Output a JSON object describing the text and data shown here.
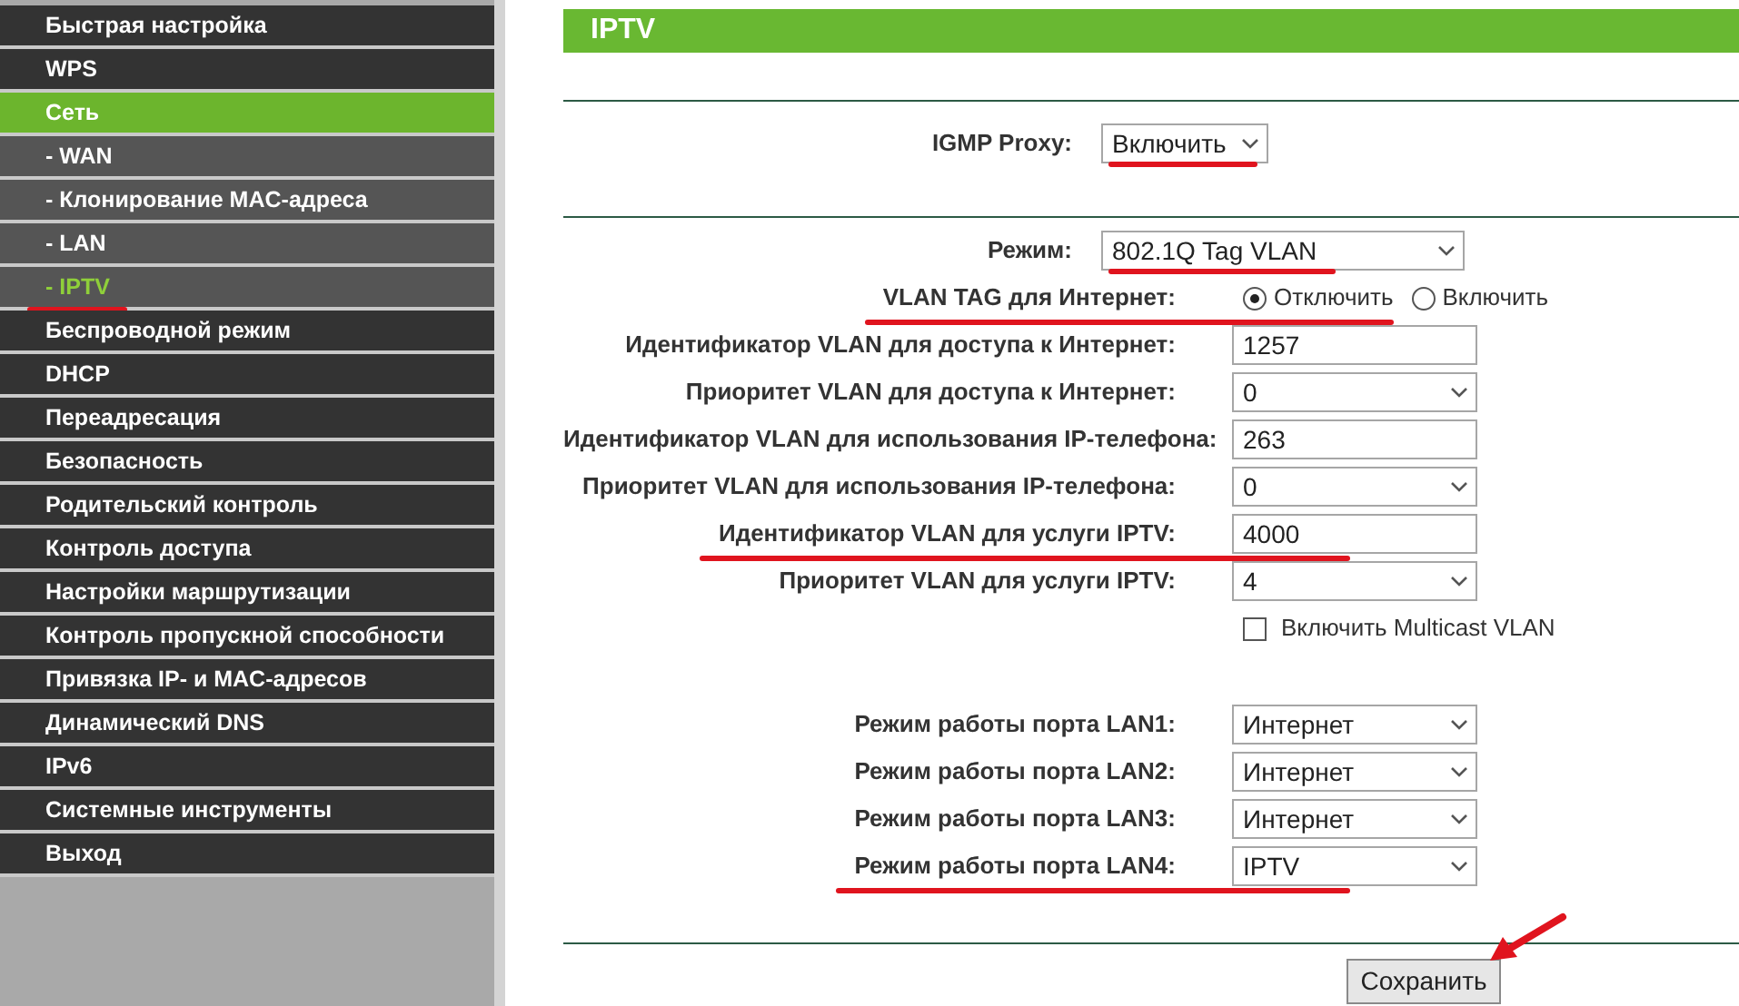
{
  "sidebar": {
    "items": [
      {
        "label": "Быстрая настройка",
        "kind": "main",
        "selected": false,
        "underlined": false
      },
      {
        "label": "WPS",
        "kind": "main",
        "selected": false,
        "underlined": false
      },
      {
        "label": "Сеть",
        "kind": "main",
        "selected": true,
        "underlined": false
      },
      {
        "label": "- WAN",
        "kind": "sub",
        "selected": false,
        "underlined": false
      },
      {
        "label": "- Клонирование MAC-адреса",
        "kind": "sub",
        "selected": false,
        "underlined": false
      },
      {
        "label": "- LAN",
        "kind": "sub",
        "selected": false,
        "underlined": false
      },
      {
        "label": "- IPTV",
        "kind": "sub",
        "selected": true,
        "underlined": true
      },
      {
        "label": "Беспроводной режим",
        "kind": "main",
        "selected": false,
        "underlined": false
      },
      {
        "label": "DHCP",
        "kind": "main",
        "selected": false,
        "underlined": false
      },
      {
        "label": "Переадресация",
        "kind": "main",
        "selected": false,
        "underlined": false
      },
      {
        "label": "Безопасность",
        "kind": "main",
        "selected": false,
        "underlined": false
      },
      {
        "label": "Родительский контроль",
        "kind": "main",
        "selected": false,
        "underlined": false
      },
      {
        "label": "Контроль доступа",
        "kind": "main",
        "selected": false,
        "underlined": false
      },
      {
        "label": "Настройки маршрутизации",
        "kind": "main",
        "selected": false,
        "underlined": false
      },
      {
        "label": "Контроль пропускной способности",
        "kind": "main",
        "selected": false,
        "underlined": false
      },
      {
        "label": "Привязка IP- и MAC-адресов",
        "kind": "main",
        "selected": false,
        "underlined": false
      },
      {
        "label": "Динамический DNS",
        "kind": "main",
        "selected": false,
        "underlined": false
      },
      {
        "label": "IPv6",
        "kind": "main",
        "selected": false,
        "underlined": false
      },
      {
        "label": "Системные инструменты",
        "kind": "main",
        "selected": false,
        "underlined": false
      },
      {
        "label": "Выход",
        "kind": "main",
        "selected": false,
        "underlined": false
      }
    ]
  },
  "panel": {
    "title": "IPTV",
    "sections": [
      {
        "rows": [
          {
            "kind": "select",
            "label": "IGMP Proxy:",
            "value": "Включить",
            "underlined": true
          }
        ]
      },
      {
        "rows": [
          {
            "kind": "select",
            "label": "Режим:",
            "value": "802.1Q Tag VLAN",
            "underlined": true
          },
          {
            "kind": "radio",
            "label": "VLAN TAG для Интернет:",
            "options": [
              {
                "label": "Отключить",
                "selected": true
              },
              {
                "label": "Включить",
                "selected": false
              }
            ],
            "underlined": true
          },
          {
            "kind": "text",
            "label": "Идентификатор VLAN для доступа к Интернет:",
            "value": "1257",
            "underlined": false
          },
          {
            "kind": "select",
            "label": "Приоритет VLAN для доступа к Интернет:",
            "value": "0",
            "underlined": false
          },
          {
            "kind": "text",
            "label": "Идентификатор VLAN для использования IP-телефона:",
            "value": "263",
            "underlined": false
          },
          {
            "kind": "select",
            "label": "Приоритет VLAN для использования IP-телефона:",
            "value": "0",
            "underlined": false
          },
          {
            "kind": "text",
            "label": "Идентификатор VLAN для услуги IPTV:",
            "value": "4000",
            "underlined": true
          },
          {
            "kind": "select",
            "label": "Приоритет VLAN для услуги IPTV:",
            "value": "4",
            "underlined": false
          },
          {
            "kind": "checkbox",
            "label": "Включить Multicast VLAN",
            "checked": false,
            "underlined": false
          },
          {
            "kind": "gap"
          },
          {
            "kind": "select",
            "label": "Режим работы порта LAN1:",
            "value": "Интернет",
            "underlined": false
          },
          {
            "kind": "select",
            "label": "Режим работы порта LAN2:",
            "value": "Интернет",
            "underlined": false
          },
          {
            "kind": "select",
            "label": "Режим работы порта LAN3:",
            "value": "Интернет",
            "underlined": false
          },
          {
            "kind": "select",
            "label": "Режим работы порта LAN4:",
            "value": "IPTV",
            "underlined": true
          }
        ]
      }
    ],
    "save_button": {
      "label": "Сохранить",
      "pointed": true
    }
  }
}
